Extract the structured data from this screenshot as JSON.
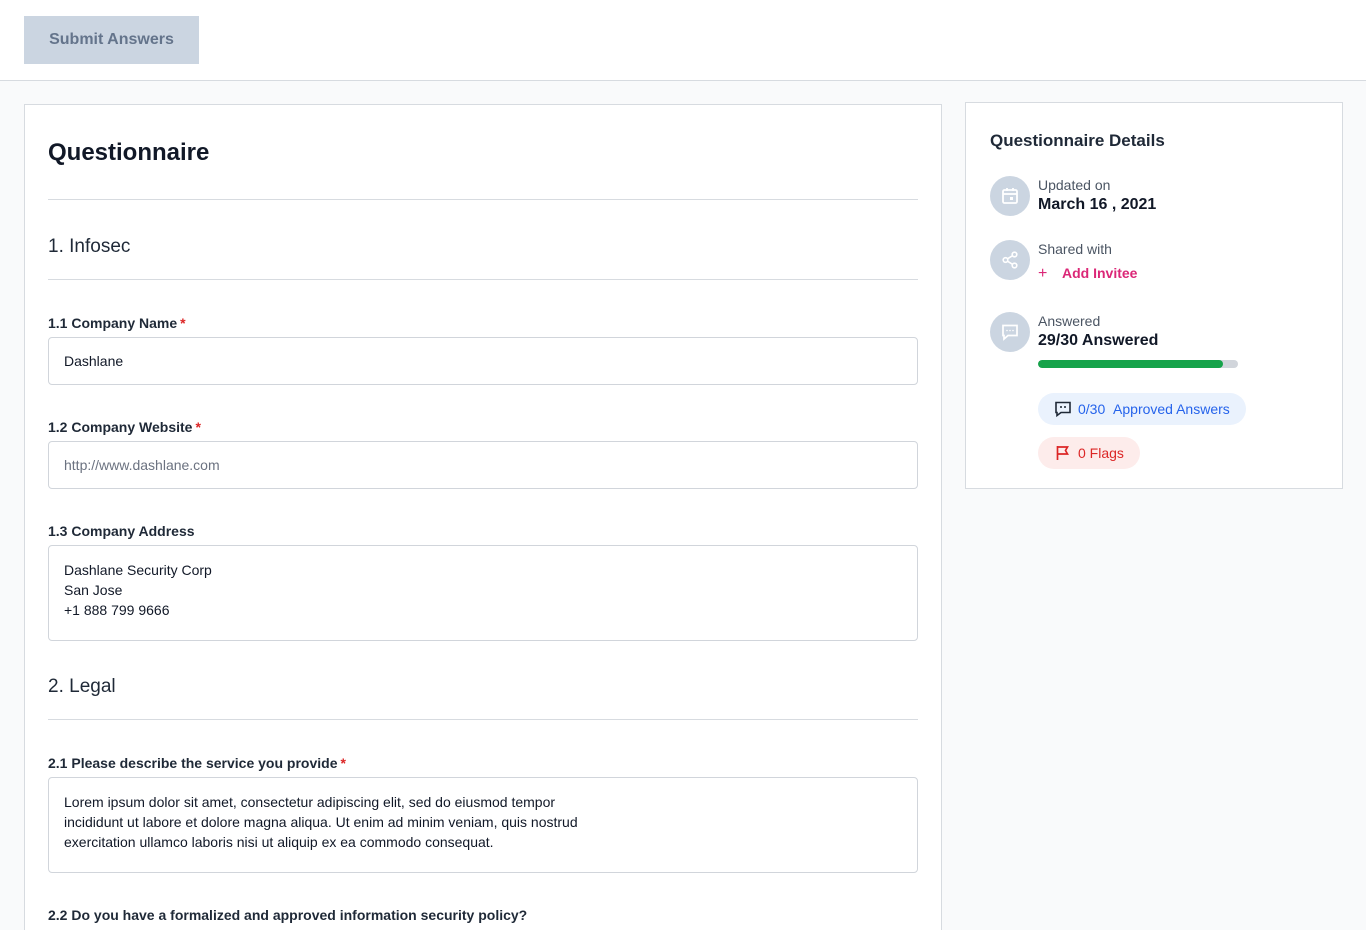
{
  "toolbar": {
    "submit_label": "Submit Answers"
  },
  "questionnaire": {
    "title": "Questionnaire",
    "sections": [
      {
        "title": "1. Infosec",
        "questions": [
          {
            "label": "1.1 Company Name",
            "required": "*",
            "value": "Dashlane"
          },
          {
            "label": "1.2 Company Website",
            "required": "*",
            "placeholder": "http://www.dashlane.com"
          },
          {
            "label": "1.3 Company Address",
            "value": "Dashlane Security Corp\nSan Jose\n+1 888 799 9666"
          }
        ]
      },
      {
        "title": "2. Legal",
        "questions": [
          {
            "label": "2.1 Please describe the service you provide",
            "required": "*",
            "value": "Lorem ipsum dolor sit amet, consectetur adipiscing elit, sed do eiusmod tempor\nincididunt ut labore et dolore magna aliqua. Ut enim ad minim veniam, quis nostrud\nexercitation ullamco laboris nisi ut aliquip ex ea commodo consequat."
          },
          {
            "label": "2.2 Do you have a formalized and approved information security policy?"
          }
        ]
      }
    ]
  },
  "details": {
    "title": "Questionnaire Details",
    "updated_label": "Updated on",
    "updated_value": "March 16 , 2021",
    "shared_label": "Shared with",
    "add_invitee": "Add Invitee",
    "answered_label": "Answered",
    "answered_value": "29/30 Answered",
    "progress_fraction": 0.925,
    "approved_count": "0/30",
    "approved_label": "Approved Answers",
    "flags_label": "0 Flags",
    "icons": {
      "updated": "calendar-icon",
      "shared": "share-icon",
      "answered": "chat-icon",
      "approved": "chat-check-icon",
      "flags": "flag-icon"
    },
    "colors": {
      "progress": "#16a34a",
      "invite": "#db2777",
      "approved": "#2563eb",
      "flags": "#dc2626"
    }
  }
}
